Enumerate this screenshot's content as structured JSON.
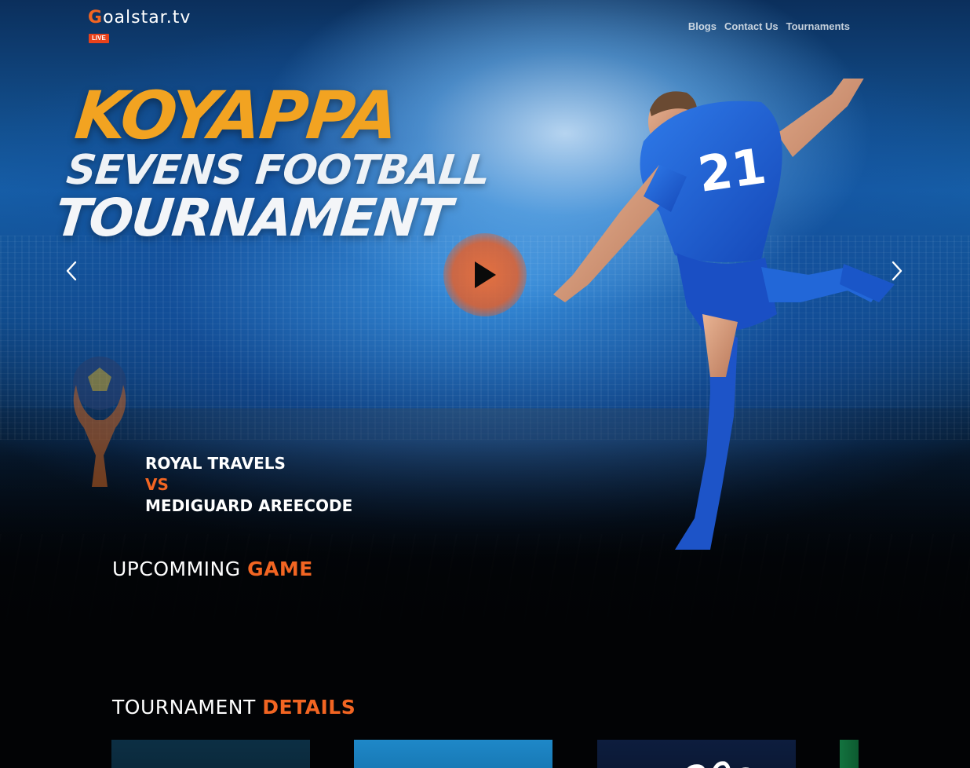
{
  "header": {
    "logo_initial": "G",
    "logo_rest": "oalstar.tv",
    "live_badge": "LIVE",
    "nav": [
      {
        "label": "Blogs"
      },
      {
        "label": "Contact Us"
      },
      {
        "label": "Tournaments"
      }
    ]
  },
  "hero": {
    "title_line1": "KOYAPPA",
    "title_line2": "SEVENS FOOTBALL",
    "title_line3": "TOURNAMENT",
    "jersey_number": "21",
    "prev_icon": "chevron-left-icon",
    "next_icon": "chevron-right-icon",
    "play_icon": "play-icon"
  },
  "match": {
    "team_home": "ROYAL TRAVELS",
    "versus": "VS",
    "team_away": "MEDIGUARD AREECODE"
  },
  "sections": {
    "upcoming_prefix": "UPCOMMING",
    "upcoming_accent": "GAME",
    "details_prefix": "TOURNAMENT",
    "details_accent": "DETAILS"
  },
  "colors": {
    "accent": "#f26522",
    "title_gold": "#f2a321",
    "live_red": "#e8421b",
    "background": "#020305"
  }
}
